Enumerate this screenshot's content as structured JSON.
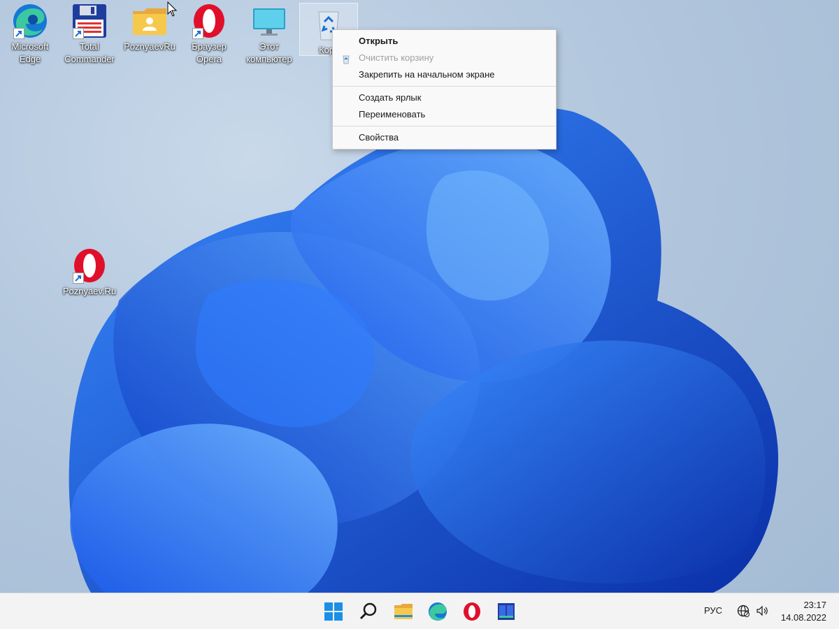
{
  "desktop": {
    "icons": [
      {
        "label": "Microsoft\nEdge"
      },
      {
        "label": "Total\nCommander"
      },
      {
        "label": "PoznyaevRu"
      },
      {
        "label": "Браузер\nOpera"
      },
      {
        "label": "Этот\nкомпьютер"
      },
      {
        "label": "Корз"
      },
      {
        "label": "Poznyaev.Ru"
      }
    ]
  },
  "context_menu": {
    "items": [
      {
        "label": "Открыть"
      },
      {
        "label": "Очистить корзину"
      },
      {
        "label": "Закрепить на начальном экране"
      },
      {
        "label": "Создать ярлык"
      },
      {
        "label": "Переименовать"
      },
      {
        "label": "Свойства"
      }
    ]
  },
  "taskbar": {
    "apps": [
      "start-icon",
      "search-icon",
      "file-explorer-icon",
      "edge-icon",
      "opera-icon",
      "total-commander-icon"
    ]
  },
  "tray": {
    "language": "РУС",
    "time": "23:17",
    "date": "14.08.2022"
  },
  "colors": {
    "accent": "#1a5fe0",
    "taskbar_bg": "#f3f3f3"
  }
}
